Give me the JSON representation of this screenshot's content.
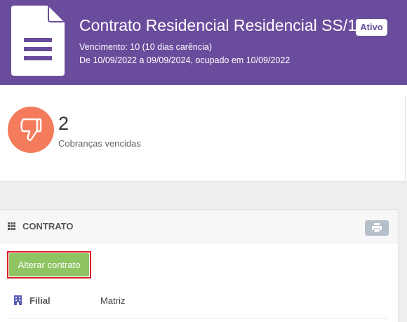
{
  "header": {
    "title": "Contrato Residencial Residencial SS/1",
    "status": "Ativo",
    "due_line": "Vencimento: 10 (10 dias carência)",
    "period_line": "De 10/09/2022 a 09/09/2024, ocupado em 10/09/2022",
    "icon": "document-icon",
    "bg_color": "#6a4c9c"
  },
  "stats": {
    "overdue": {
      "value": "2",
      "label": "Cobranças vencidas",
      "icon": "thumbs-down-icon",
      "color": "#f47c5c"
    }
  },
  "contract_panel": {
    "title": "CONTRATO",
    "title_icon": "grid-icon",
    "print_icon": "print-icon",
    "alter_button": "Alterar contrato",
    "alter_button_color": "#8fc463",
    "highlight_color": "#dd1f26",
    "fields": [
      {
        "icon": "building-icon",
        "label": "Filial",
        "value": "Matriz"
      }
    ]
  }
}
